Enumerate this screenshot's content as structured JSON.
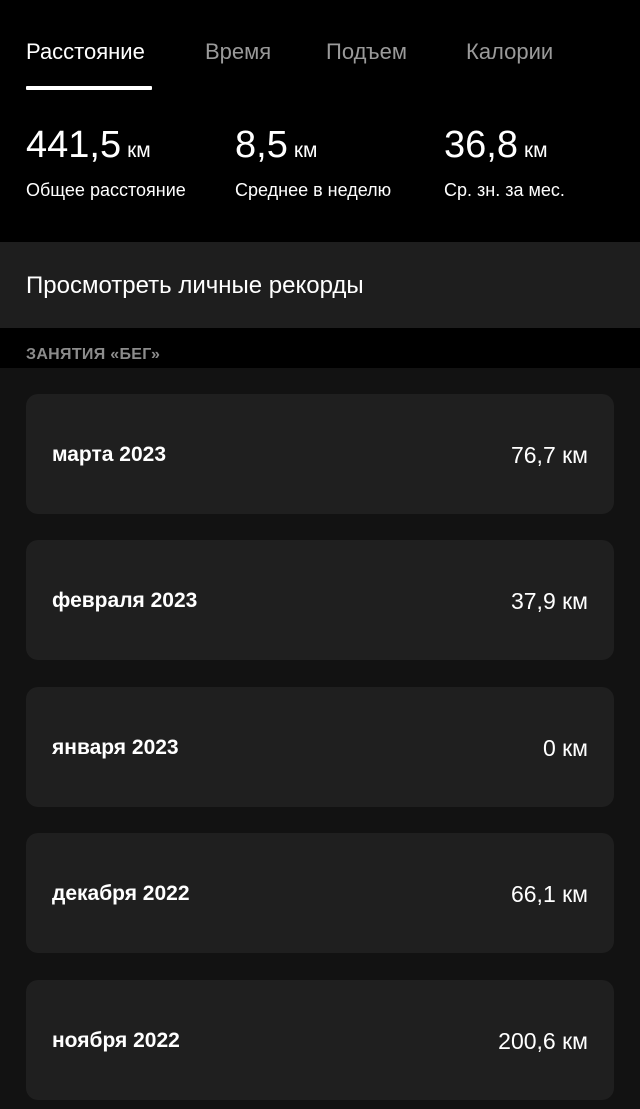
{
  "tabs": [
    {
      "label": "Расстояние",
      "active": true
    },
    {
      "label": "Время",
      "active": false
    },
    {
      "label": "Подъем",
      "active": false
    },
    {
      "label": "Калории",
      "active": false
    }
  ],
  "stats": [
    {
      "value": "441,5",
      "unit": "км",
      "label": "Общее расстояние"
    },
    {
      "value": "8,5",
      "unit": "км",
      "label": "Среднее в неделю"
    },
    {
      "value": "36,8",
      "unit": "км",
      "label": "Ср. зн. за мес."
    }
  ],
  "records": {
    "label": "Просмотреть личные рекорды"
  },
  "section": {
    "title": "ЗАНЯТИЯ «БЕГ»"
  },
  "months": [
    {
      "label": "марта 2023",
      "value": "76,7 км"
    },
    {
      "label": "февраля 2023",
      "value": "37,9 км"
    },
    {
      "label": "января 2023",
      "value": "0 км"
    },
    {
      "label": "декабря 2022",
      "value": "66,1 км"
    },
    {
      "label": "ноября 2022",
      "value": "200,6 км"
    }
  ],
  "colors": {
    "background": "#000000",
    "list_background": "#121212",
    "card_background": "#1f1f1f",
    "inactive_tab": "#9a9a9a",
    "section_header": "#8c8c8c"
  }
}
